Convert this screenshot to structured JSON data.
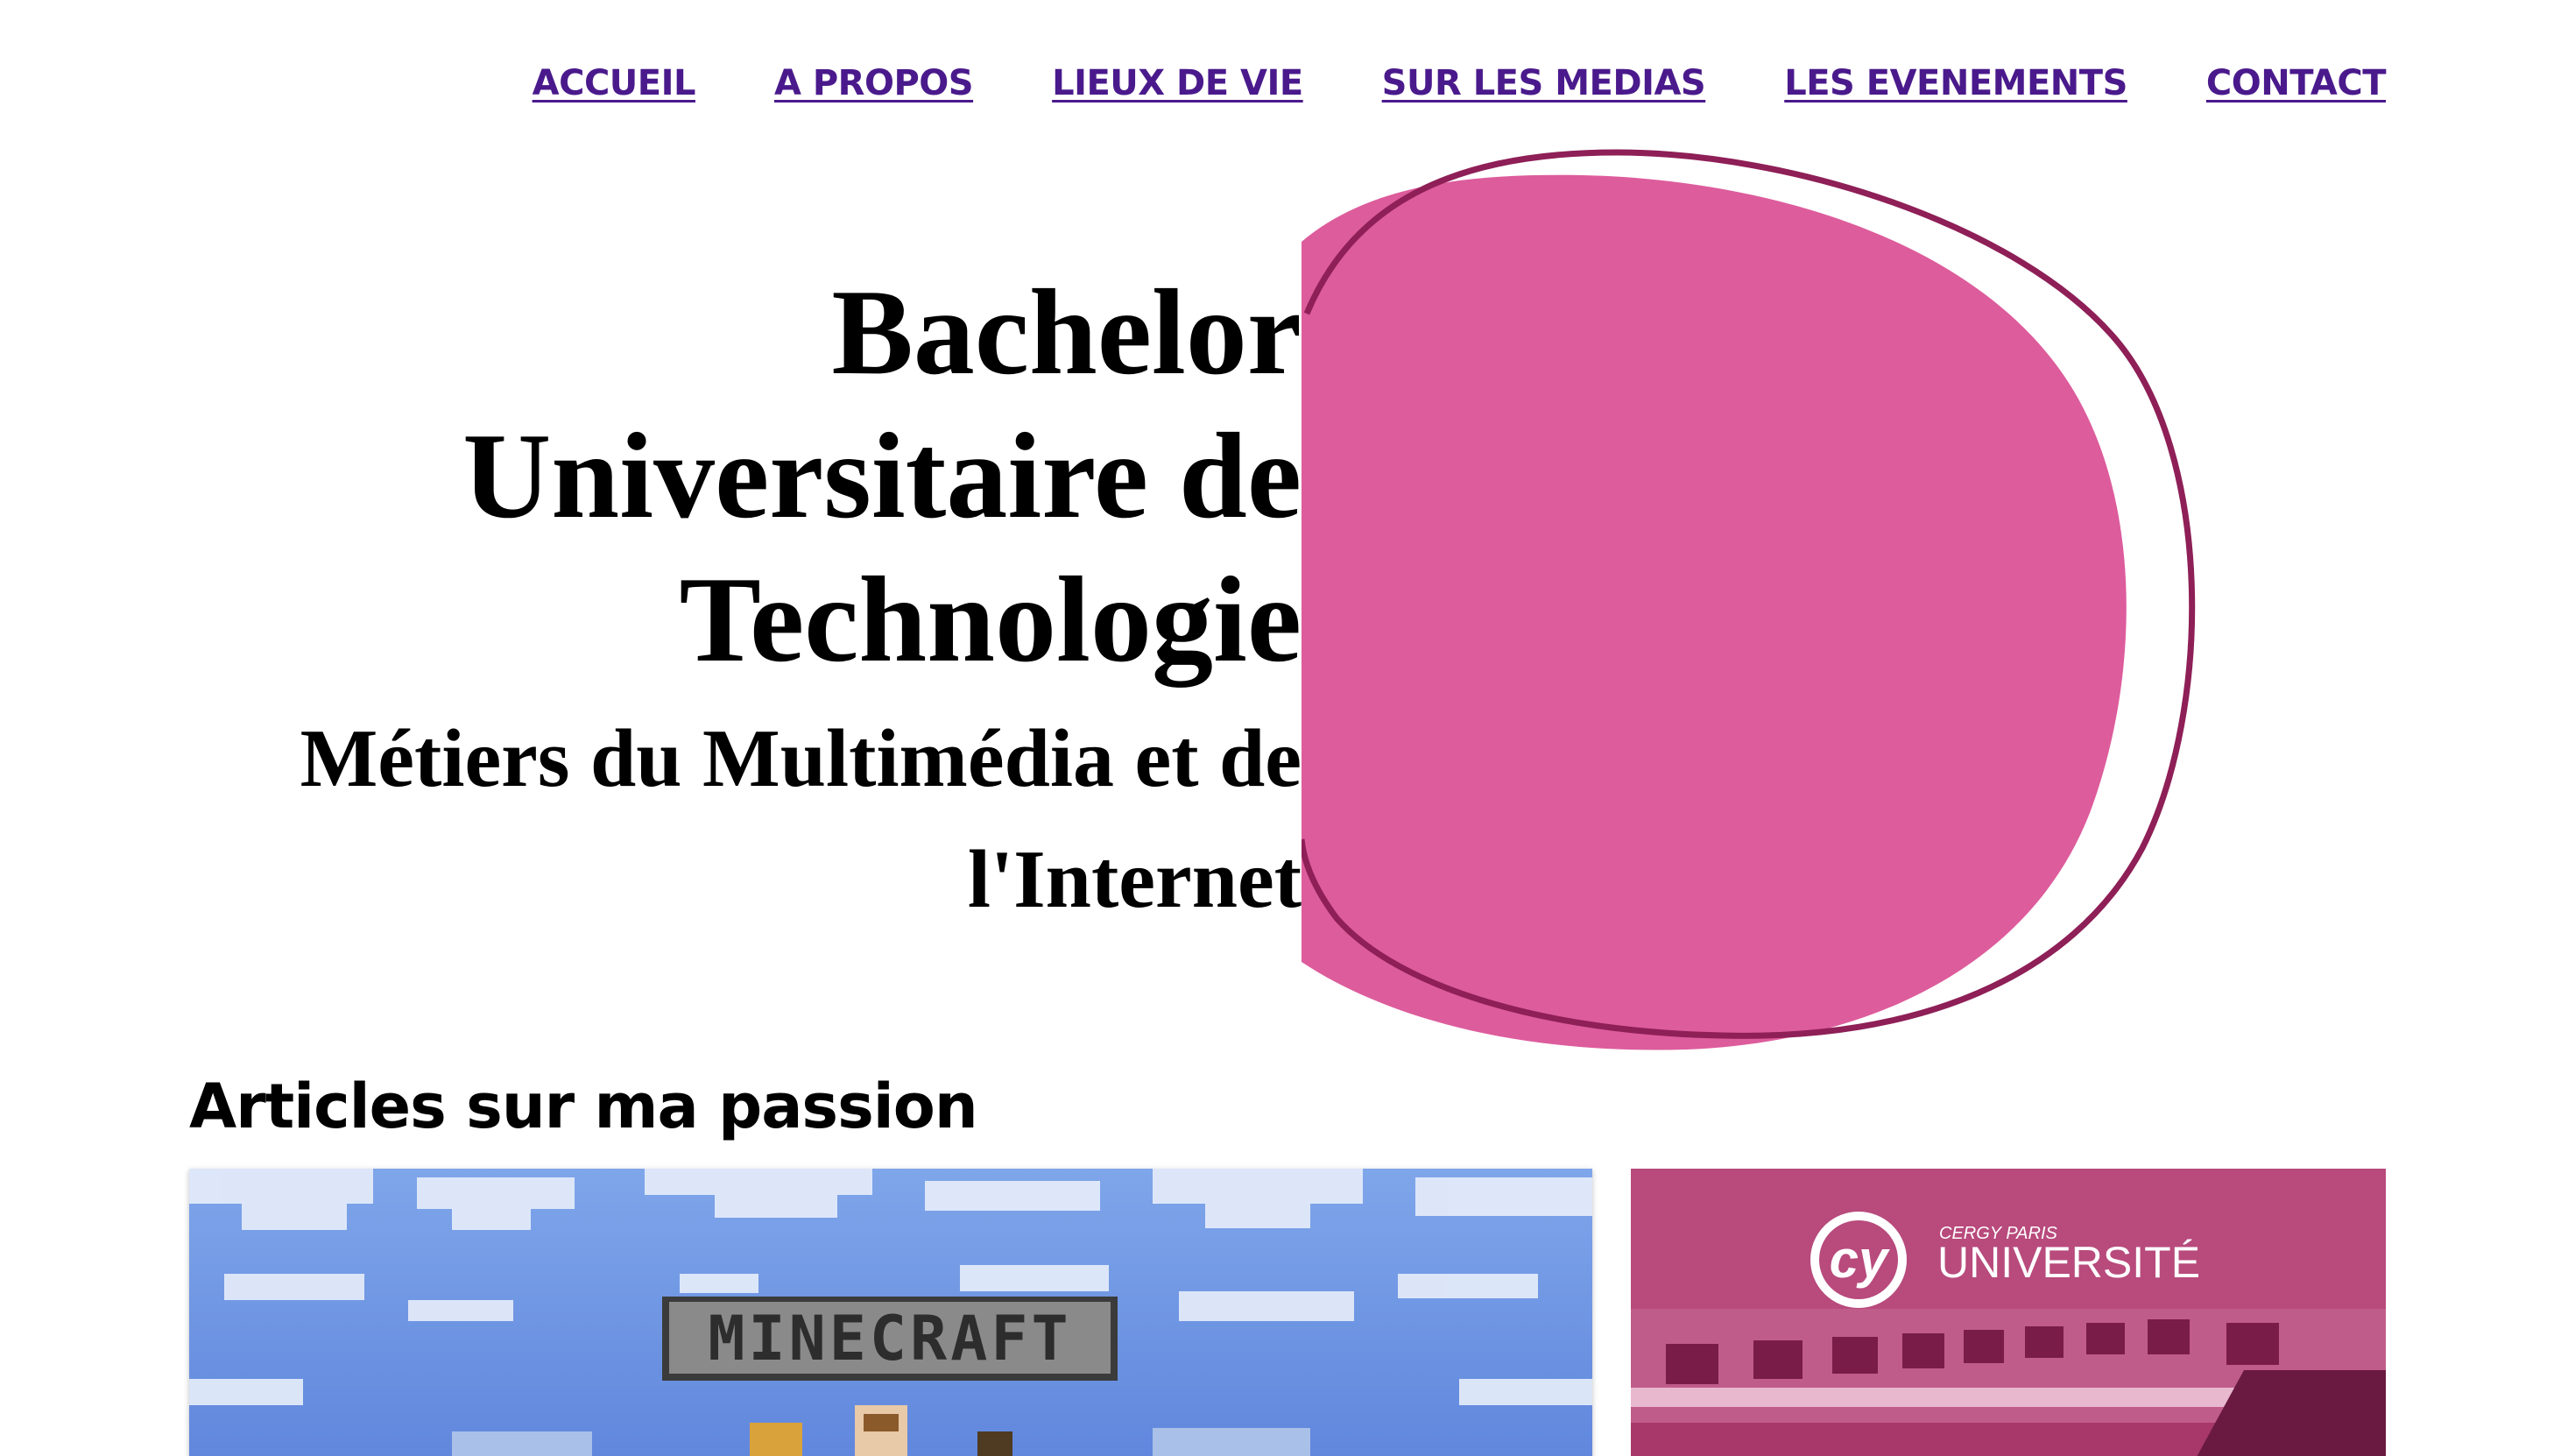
{
  "nav": {
    "items": [
      {
        "label": "ACCUEIL",
        "name": "nav-accueil"
      },
      {
        "label": "A PROPOS",
        "name": "nav-a-propos"
      },
      {
        "label": "LIEUX DE VIE",
        "name": "nav-lieux-de-vie"
      },
      {
        "label": "SUR LES MEDIAS",
        "name": "nav-sur-les-medias"
      },
      {
        "label": "LES EVENEMENTS",
        "name": "nav-les-evenements"
      },
      {
        "label": "CONTACT",
        "name": "nav-contact"
      }
    ],
    "link_color": "#4a1a8c"
  },
  "hero": {
    "title_line1": "Bachelor",
    "title_line2": "Universitaire de",
    "title_line3": "Technologie",
    "subtitle_line1": "Métiers du Multimédia et de",
    "subtitle_line2": "l'Internet",
    "shape_fill": "#dd5c9c",
    "shape_stroke": "#8e1f57"
  },
  "articles": {
    "heading": "Articles sur ma passion",
    "cards": [
      {
        "name": "minecraft-card",
        "logo_text": "MINECRAFT",
        "icon": "minecraft-logo"
      },
      {
        "name": "cy-universite-card",
        "logo_small": "CERGY PARIS",
        "logo_large": "UNIVERSITÉ",
        "icon": "cy-logo",
        "overlay_color": "#b0306c"
      }
    ]
  }
}
